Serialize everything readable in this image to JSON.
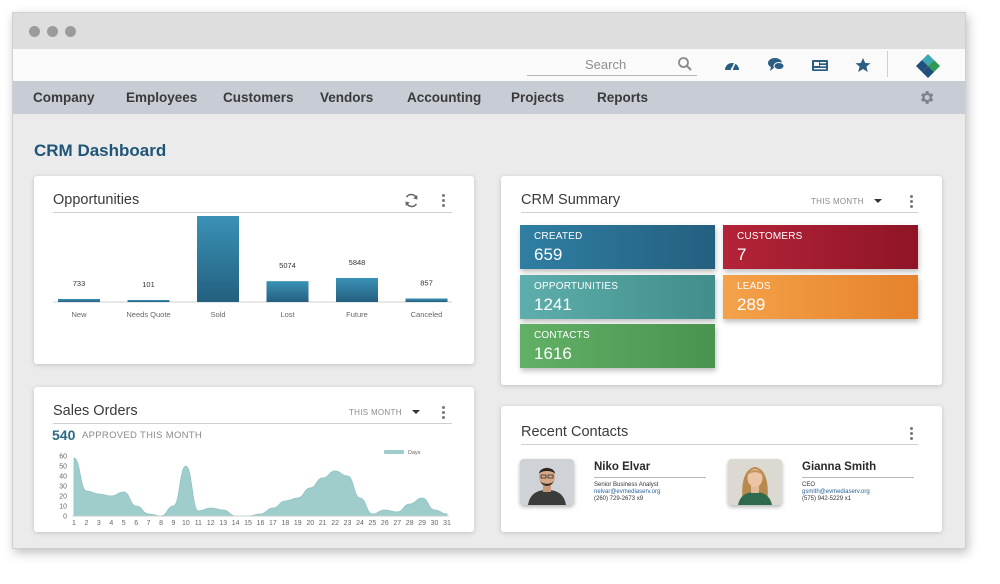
{
  "topbar": {
    "search_placeholder": "Search",
    "icons": [
      "dashboard-icon",
      "chat-icon",
      "newspaper-icon",
      "star-icon"
    ]
  },
  "nav": {
    "items": [
      "Company",
      "Employees",
      "Customers",
      "Vendors",
      "Accounting",
      "Projects",
      "Reports"
    ]
  },
  "page": {
    "title": "CRM Dashboard"
  },
  "opportunities": {
    "title": "Opportunities",
    "chart_data": {
      "type": "bar",
      "categories": [
        "New",
        "Needs Quote",
        "Sold",
        "Lost",
        "Future",
        "Canceled"
      ],
      "values": [
        733,
        101,
        20929,
        5074,
        5848,
        857
      ],
      "labels": [
        "733",
        "101",
        "20929",
        "5074",
        "5848",
        "857"
      ],
      "color": "#2f7fa3"
    }
  },
  "crm_summary": {
    "title": "CRM Summary",
    "period": "THIS MONTH",
    "tiles": [
      {
        "label": "CREATED",
        "value": "659",
        "color": "#2f7fa3"
      },
      {
        "label": "CUSTOMERS",
        "value": "7",
        "color": "#b52338"
      },
      {
        "label": "OPPORTUNITIES",
        "value": "1241",
        "color": "#56aaa8"
      },
      {
        "label": "LEADS",
        "value": "289",
        "color": "#ef963c"
      },
      {
        "label": "CONTACTS",
        "value": "1616",
        "color": "#5aa95f"
      }
    ]
  },
  "sales_orders": {
    "title": "Sales Orders",
    "period": "THIS MONTH",
    "count": "540",
    "count_label": "APPROVED THIS MONTH",
    "chart_data": {
      "type": "area",
      "x": [
        1,
        2,
        3,
        4,
        5,
        6,
        7,
        8,
        9,
        10,
        11,
        12,
        13,
        14,
        15,
        16,
        17,
        18,
        19,
        20,
        21,
        22,
        23,
        24,
        25,
        26,
        27,
        28,
        29,
        30,
        31
      ],
      "series": [
        {
          "name": "Days",
          "values": [
            58,
            25,
            22,
            20,
            24,
            10,
            2,
            0,
            10,
            50,
            5,
            8,
            6,
            0,
            0,
            2,
            8,
            15,
            18,
            28,
            38,
            45,
            40,
            18,
            2,
            6,
            4,
            12,
            18,
            6,
            2
          ]
        }
      ],
      "y_ticks": [
        "0",
        "10",
        "20",
        "30",
        "40",
        "50",
        "60"
      ],
      "ylim": [
        0,
        60
      ],
      "color": "#9fcdcc"
    }
  },
  "recent_contacts": {
    "title": "Recent Contacts",
    "contacts": [
      {
        "name": "Niko Elvar",
        "role": "Senior Business Analyst",
        "email": "nelvar@evmediaserv.org",
        "phone": "(260) 729-2673 x9"
      },
      {
        "name": "Gianna Smith",
        "role": "CEO",
        "email": "gsmith@evmediaserv.org",
        "phone": "(575) 942-5229 x1"
      }
    ]
  }
}
